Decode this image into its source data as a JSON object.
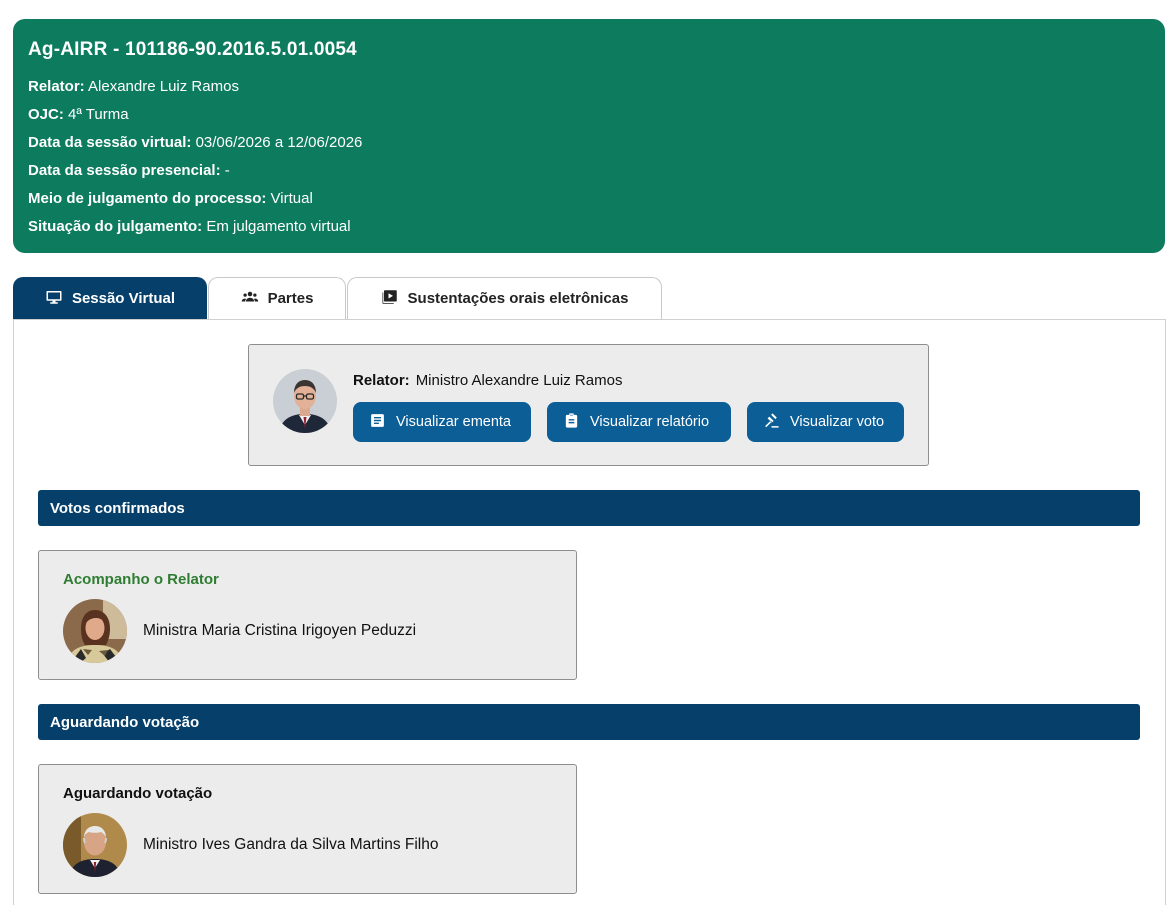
{
  "header": {
    "title": "Ag-AIRR - 101186-90.2016.5.01.0054",
    "rows": [
      {
        "label": "Relator:",
        "value": "Alexandre Luiz Ramos"
      },
      {
        "label": "OJC:",
        "value": "4ª Turma"
      },
      {
        "label": "Data da sessão virtual:",
        "value": "03/06/2026 a 12/06/2026"
      },
      {
        "label": "Data da sessão presencial:",
        "value": "-"
      },
      {
        "label": "Meio de julgamento do processo:",
        "value": "Virtual"
      },
      {
        "label": "Situação do julgamento:",
        "value": "Em julgamento virtual"
      }
    ],
    "color": "#0c7b5e"
  },
  "tabs": [
    {
      "label": "Sessão Virtual",
      "icon": "monitor-icon",
      "active": true
    },
    {
      "label": "Partes",
      "icon": "people-icon",
      "active": false
    },
    {
      "label": "Sustentações orais eletrônicas",
      "icon": "video-play-icon",
      "active": false
    }
  ],
  "relator_card": {
    "label": "Relator:",
    "name": "Ministro Alexandre Luiz Ramos",
    "buttons": [
      {
        "label": "Visualizar ementa",
        "icon": "document-icon"
      },
      {
        "label": "Visualizar relatório",
        "icon": "clipboard-icon"
      },
      {
        "label": "Visualizar voto",
        "icon": "gavel-icon"
      }
    ]
  },
  "sections": [
    {
      "title": "Votos confirmados",
      "vote": {
        "status": "Acompanho o Relator",
        "status_color": "#2e7d32",
        "name": "Ministra Maria Cristina Irigoyen Peduzzi"
      }
    },
    {
      "title": "Aguardando votação",
      "vote": {
        "status": "Aguardando votação",
        "status_color": "#111111",
        "name": "Ministro Ives Gandra da Silva Martins Filho"
      }
    }
  ],
  "colors": {
    "primary_dark": "#06406a",
    "button": "#0b5e96",
    "card_bg": "#ececec"
  }
}
